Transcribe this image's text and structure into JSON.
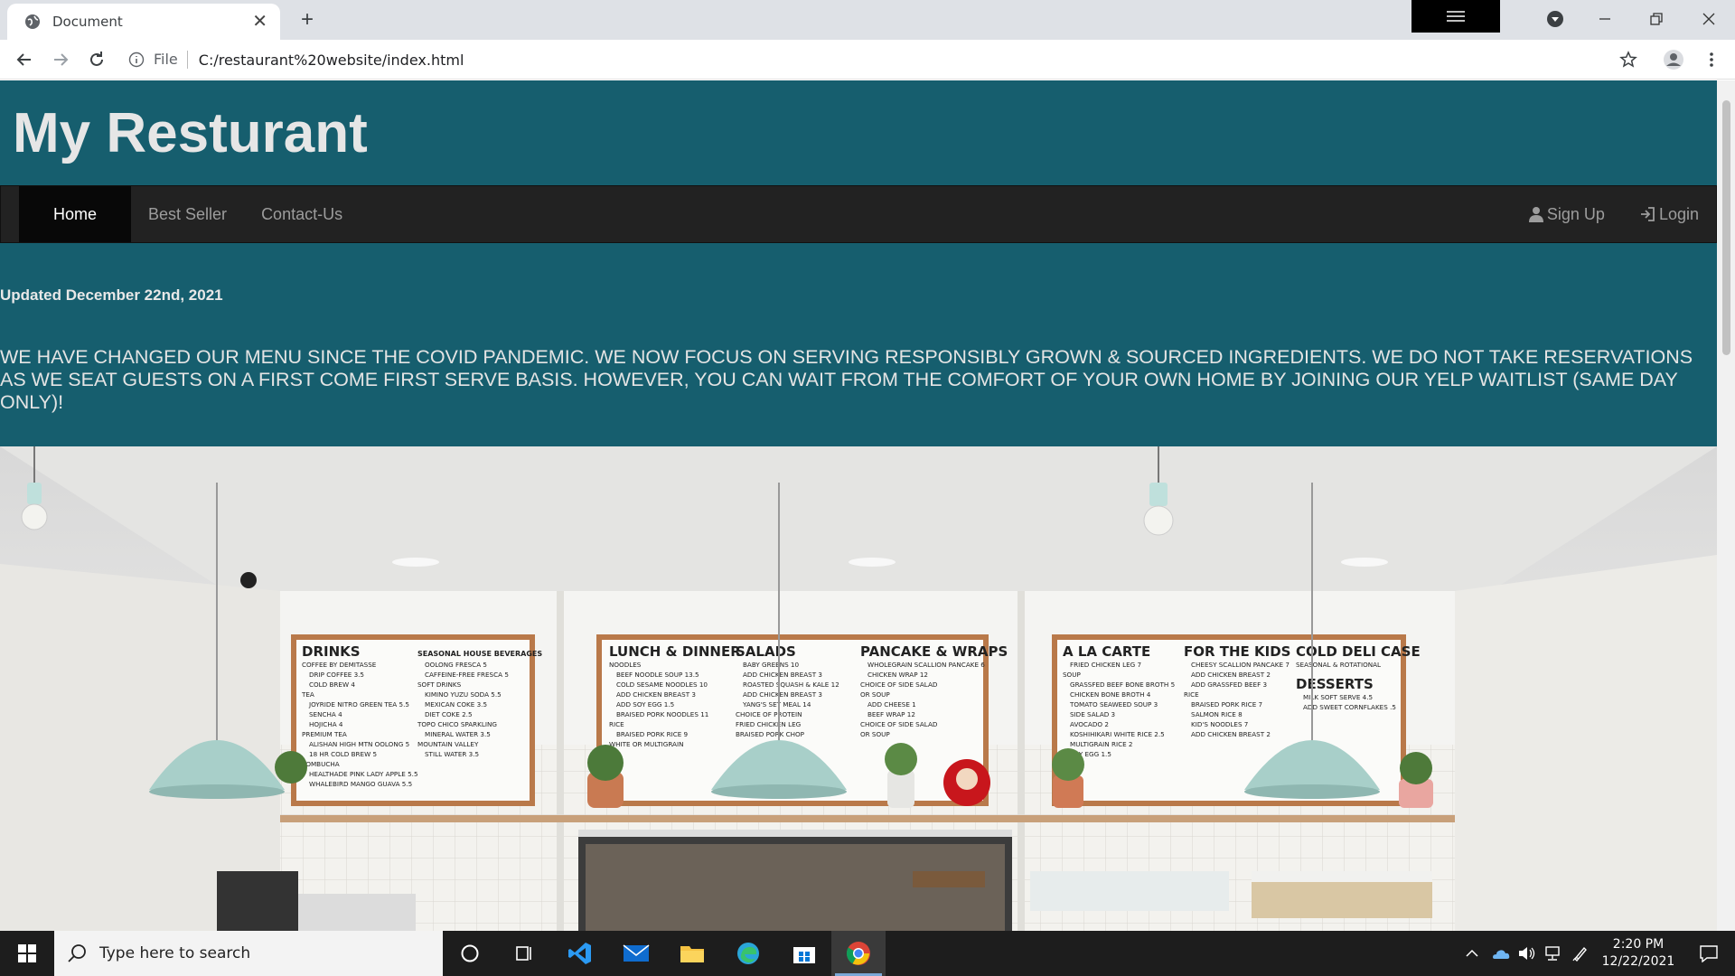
{
  "browser": {
    "tab_title": "Document",
    "address_scheme_label": "File",
    "url": "C:/restaurant%20website/index.html"
  },
  "site": {
    "title": "My Resturant",
    "nav": {
      "home": "Home",
      "best_seller": "Best Seller",
      "contact": "Contact-Us",
      "sign_up": "Sign Up",
      "login": "Login"
    },
    "updated": "Updated December 22nd, 2021",
    "notice": "WE HAVE CHANGED OUR MENU SINCE THE COVID PANDEMIC. WE NOW FOCUS ON SERVING RESPONSIBLY GROWN & SOURCED INGREDIENTS. WE DO NOT TAKE RESERVATIONS AS WE SEAT GUESTS ON A FIRST COME FIRST SERVE BASIS. HOWEVER, YOU CAN WAIT FROM THE COMFORT OF YOUR OWN HOME BY JOINING OUR YELP WAITLIST (SAME DAY ONLY)!"
  },
  "hero": {
    "boards": [
      {
        "heading": "DRINKS",
        "lines": [
          "COFFEE BY DEMITASSE",
          "DRIP COFFEE  3.5",
          "COLD BREW  4",
          "TEA",
          "JOYRIDE NITRO GREEN TEA 5.5",
          "SENCHA  4",
          "HOJICHA  4",
          "PREMIUM TEA",
          "ALISHAN HIGH MTN OOLONG 5",
          "18 HR COLD BREW  5",
          "KOMBUCHA",
          "HEALTHADE PINK LADY APPLE 5.5",
          "WHALEBIRD MANGO GUAVA 5.5"
        ]
      },
      {
        "heading": "SEASONAL HOUSE BEVERAGES",
        "lines": [
          "OOLONG FRESCA  5",
          "CAFFEINE-FREE FRESCA  5",
          "SOFT DRINKS",
          "KIMINO YUZU SODA  5.5",
          "MEXICAN COKE  3.5",
          "DIET COKE  2.5",
          "TOPO CHICO SPARKLING",
          "MINERAL WATER  3.5",
          "MOUNTAIN VALLEY",
          "STILL WATER  3.5"
        ]
      },
      {
        "heading": "LUNCH & DINNER",
        "lines": [
          "NOODLES",
          "BEEF NOODLE SOUP  13.5",
          "COLD SESAME NOODLES  10",
          "ADD CHICKEN BREAST  3",
          "ADD SOY EGG  1.5",
          "BRAISED PORK NOODLES  11",
          "RICE",
          "BRAISED PORK RICE  9",
          "WHITE OR MULTIGRAIN"
        ]
      },
      {
        "heading": "SALADS",
        "lines": [
          "BABY GREENS  10",
          "ADD CHICKEN BREAST  3",
          "ROASTED SQUASH & KALE  12",
          "ADD CHICKEN BREAST  3",
          "YANG'S SET MEAL  14",
          "CHOICE OF PROTEIN",
          "FRIED CHICKEN LEG",
          "BRAISED PORK CHOP"
        ]
      },
      {
        "heading": "PANCAKE & WRAPS",
        "lines": [
          "WHOLEGRAIN SCALLION PANCAKE 6",
          "CHICKEN WRAP  12",
          "CHOICE OF SIDE SALAD",
          "OR SOUP",
          "ADD CHEESE  1",
          "BEEF WRAP  12",
          "CHOICE OF SIDE SALAD",
          "OR SOUP"
        ]
      },
      {
        "heading": "A LA CARTE",
        "lines": [
          "FRIED CHICKEN LEG  7",
          "SOUP",
          "GRASSFED BEEF BONE BROTH 5",
          "CHICKEN BONE BROTH  4",
          "TOMATO SEAWEED SOUP  3",
          "SIDE SALAD  3",
          "AVOCADO  2",
          "KOSHIHIKARI WHITE RICE  2.5",
          "MULTIGRAIN RICE  2",
          "SOY EGG  1.5"
        ]
      },
      {
        "heading": "FOR THE KIDS",
        "lines": [
          "CHEESY SCALLION PANCAKE 7",
          "ADD CHICKEN BREAST  2",
          "ADD GRASSFED BEEF  3",
          "RICE",
          "BRAISED PORK RICE  7",
          "SALMON RICE  8",
          "KID'S NOODLES  7",
          "ADD CHICKEN BREAST  2"
        ]
      },
      {
        "heading": "COLD DELI CASE",
        "lines": [
          "SEASONAL & ROTATIONAL"
        ]
      },
      {
        "heading": "DESSERTS",
        "lines": [
          "MILK SOFT SERVE  4.5",
          "ADD SWEET CORNFLAKES  .5"
        ]
      }
    ]
  },
  "taskbar": {
    "search_placeholder": "Type here to search",
    "time": "2:20 PM",
    "date": "12/22/2021"
  }
}
